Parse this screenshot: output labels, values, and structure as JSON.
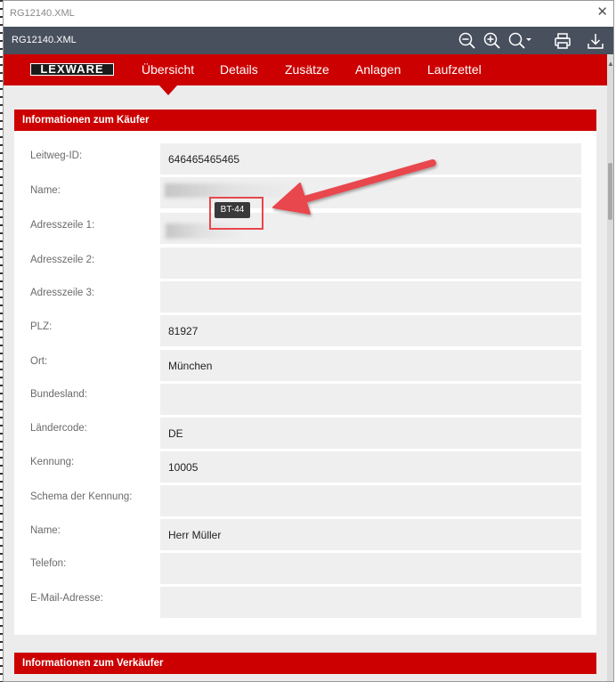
{
  "window": {
    "title": "RG12140.XML",
    "close_glyph": "✕"
  },
  "toolbar": {
    "filename": "RG12140.XML",
    "icons": [
      "zoom-out-icon",
      "zoom-in-icon",
      "zoom-dropdown-icon",
      "print-icon",
      "download-icon"
    ]
  },
  "nav": {
    "logo": "LEXWARE",
    "tabs": [
      {
        "label": "Übersicht",
        "active": true
      },
      {
        "label": "Details",
        "active": false
      },
      {
        "label": "Zusätze",
        "active": false
      },
      {
        "label": "Anlagen",
        "active": false
      },
      {
        "label": "Laufzettel",
        "active": false
      }
    ]
  },
  "buyer": {
    "heading": "Informationen zum Käufer",
    "fields": [
      {
        "label": "Leitweg-ID:",
        "value": "646465465465"
      },
      {
        "label": "Name:",
        "value": ""
      },
      {
        "label": "Adresszeile 1:",
        "value": ""
      },
      {
        "label": "Adresszeile 2:",
        "value": ""
      },
      {
        "label": "Adresszeile 3:",
        "value": ""
      },
      {
        "label": "PLZ:",
        "value": "81927"
      },
      {
        "label": "Ort:",
        "value": "München"
      },
      {
        "label": "Bundesland:",
        "value": ""
      },
      {
        "label": "Ländercode:",
        "value": "DE"
      },
      {
        "label": "Kennung:",
        "value": "10005"
      },
      {
        "label": "Schema der Kennung:",
        "value": ""
      },
      {
        "label": "Name:",
        "value": "Herr Müller"
      },
      {
        "label": "Telefon:",
        "value": ""
      },
      {
        "label": "E-Mail-Adresse:",
        "value": ""
      }
    ]
  },
  "seller": {
    "heading": "Informationen zum Verkäufer"
  },
  "tooltip": {
    "text": "BT-44"
  },
  "colors": {
    "brand_red": "#cc0000",
    "toolbar_bg": "#48505e",
    "annotation_red": "#e8474d"
  }
}
